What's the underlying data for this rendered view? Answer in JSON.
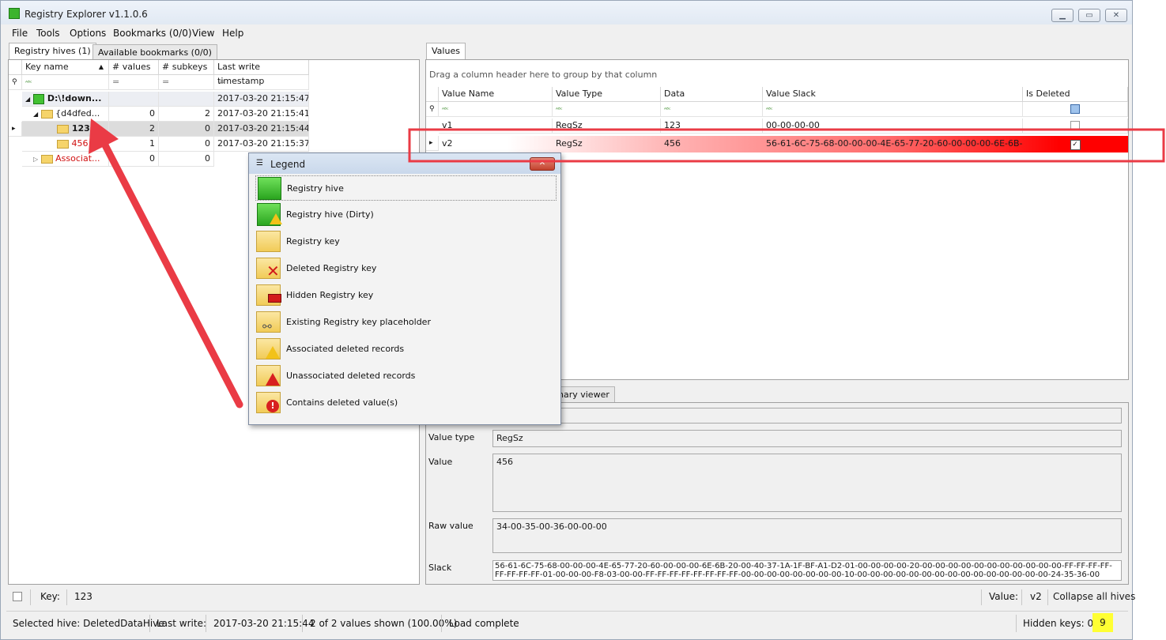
{
  "window": {
    "title": "Registry Explorer v1.1.0.6",
    "min_icon": "minimize-icon",
    "max_icon": "maximize-icon",
    "close_icon": "close-icon"
  },
  "menu": [
    "File",
    "Tools",
    "Options",
    "Bookmarks (0/0)",
    "View",
    "Help"
  ],
  "left_tabs": [
    "Registry hives (1)",
    "Available bookmarks (0/0)"
  ],
  "tree": {
    "columns": [
      "Key name",
      "# values",
      "# subkeys",
      "Last write timestamp"
    ],
    "rows": [
      {
        "name": "D:\\!down...",
        "values": "",
        "subkeys": "",
        "ts": "2017-03-20 21:15:47"
      },
      {
        "name": "{d4dfed...",
        "values": "0",
        "subkeys": "2",
        "ts": "2017-03-20 21:15:41"
      },
      {
        "name": "123",
        "values": "2",
        "subkeys": "0",
        "ts": "2017-03-20 21:15:44"
      },
      {
        "name": "456",
        "values": "1",
        "subkeys": "0",
        "ts": "2017-03-20 21:15:37"
      },
      {
        "name": "Associat...",
        "values": "0",
        "subkeys": "0",
        "ts": ""
      }
    ]
  },
  "values_tab": "Values",
  "values_grid": {
    "group_hint": "Drag a column header here to group by that column",
    "columns": [
      "Value Name",
      "Value Type",
      "Data",
      "Value Slack",
      "Is Deleted"
    ],
    "rows": [
      {
        "name": "v1",
        "type": "RegSz",
        "data": "123",
        "slack": "00-00-00-00",
        "deleted": false
      },
      {
        "name": "v2",
        "type": "RegSz",
        "data": "456",
        "slack": "56-61-6C-75-68-00-00-00-4E-65-77-20-60-00-00-00-6E-6B-20-0...",
        "deleted": true
      }
    ]
  },
  "legend": {
    "title": "Legend",
    "items": [
      "Registry hive",
      "Registry hive (Dirty)",
      "Registry key",
      "Deleted Registry key",
      "Hidden Registry key",
      "Existing Registry key placeholder",
      "Associated deleted records",
      "Unassociated deleted records",
      "Contains deleted value(s)"
    ]
  },
  "detail": {
    "tab_partial": "nary viewer",
    "value_type_label": "Value type",
    "value_type": "RegSz",
    "value_label": "Value",
    "value": "456",
    "raw_label": "Raw value",
    "raw": "34-00-35-00-36-00-00-00",
    "slack_label": "Slack",
    "slack_line1": "56-61-6C-75-68-00-00-00-4E-65-77-20-60-00-00-00-6E-6B-20-00-40-37-1A-1F-BF-A1-D2-01-00-00-00-00-20-00-00-00-00-00-00-00-00-00-00-00-FF-FF-FF-FF-",
    "slack_line2": "FF-FF-FF-FF-01-00-00-00-F8-03-00-00-FF-FF-FF-FF-FF-FF-FF-FF-00-00-00-00-00-00-00-00-10-00-00-00-00-00-00-00-00-00-00-00-00-00-00-00-24-35-36-00"
  },
  "keybar": {
    "key_label": "Key:",
    "key": "123",
    "value_label": "Value:",
    "value": "v2",
    "collapse": "Collapse all hives"
  },
  "status": {
    "hive": "Selected hive: DeletedDataHive",
    "lastwrite_label": "Last write:",
    "lastwrite": "2017-03-20 21:15:44",
    "shown": "2 of 2 values shown (100.00%)",
    "load": "Load complete",
    "hidden": "Hidden keys: 0",
    "badge": "9"
  },
  "colors": {
    "highlight_red": "#ff0000",
    "annotation_red": "#ea3b45",
    "hive_green": "#3db42e",
    "folder_yellow": "#f6d46a",
    "status_badge": "#ffff33"
  }
}
